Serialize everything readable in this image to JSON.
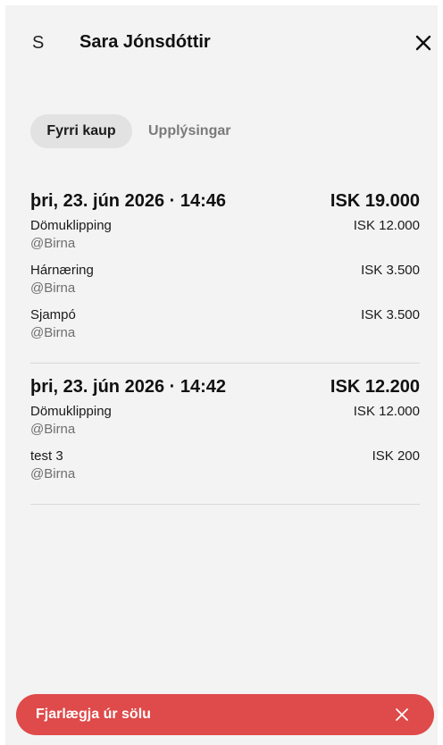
{
  "header": {
    "avatar_initial": "S",
    "customer_name": "Sara Jónsdóttir",
    "close_icon": "close-icon"
  },
  "tabs": [
    {
      "label": "Fyrri kaup",
      "active": true
    },
    {
      "label": "Upplýsingar",
      "active": false
    }
  ],
  "purchases": [
    {
      "date": "þri, 23. jún 2026 · 14:46",
      "total": "ISK 19.000",
      "items": [
        {
          "name": "Dömuklipping",
          "staff": "@Birna",
          "price": "ISK 12.000"
        },
        {
          "name": "Hárnæring",
          "staff": "@Birna",
          "price": "ISK 3.500"
        },
        {
          "name": "Sjampó",
          "staff": "@Birna",
          "price": "ISK 3.500"
        }
      ]
    },
    {
      "date": "þri, 23. jún 2026 · 14:42",
      "total": "ISK 12.200",
      "items": [
        {
          "name": "Dömuklipping",
          "staff": "@Birna",
          "price": "ISK 12.000"
        },
        {
          "name": "test 3",
          "staff": "@Birna",
          "price": "ISK 200"
        }
      ]
    }
  ],
  "bottom_bar": {
    "label": "Fjarlægja úr sölu",
    "close_icon": "close-icon",
    "color": "#df4a4a"
  },
  "colors": {
    "panel_bg": "#f3f3f3",
    "active_tab_bg": "#e2e2e2",
    "muted_text": "#6f6f6f"
  }
}
